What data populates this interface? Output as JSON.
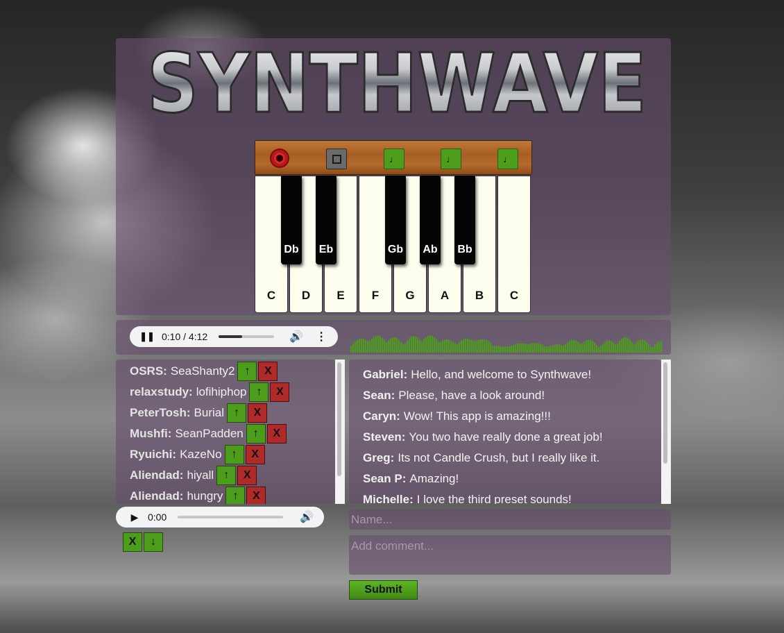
{
  "app": {
    "title": "SYNTHWAVE",
    "accent_green": "#4d9d1c",
    "accent_red": "#b12a2a",
    "panel_color": "#684e6c"
  },
  "piano": {
    "controls": [
      {
        "name": "record-button",
        "icon": "record-icon"
      },
      {
        "name": "stop-button",
        "icon": "stop-icon"
      },
      {
        "name": "preset-1-button",
        "icon": "music-note-icon",
        "glyph": "♩"
      },
      {
        "name": "preset-2-button",
        "icon": "music-note-icon",
        "glyph": "♩"
      },
      {
        "name": "preset-3-button",
        "icon": "music-note-icon",
        "glyph": "♩"
      }
    ],
    "white_keys": [
      "C",
      "D",
      "E",
      "F",
      "G",
      "A",
      "B",
      "C"
    ],
    "black_keys": [
      "Db",
      "Eb",
      "Gb",
      "Ab",
      "Bb"
    ]
  },
  "main_player": {
    "time": "0:10 / 4:12",
    "progress_fraction": 0.42,
    "icons": [
      "pause-icon",
      "volume-icon",
      "more-options-icon"
    ]
  },
  "queue": [
    {
      "user": "OSRS:",
      "track": "SeaShanty2",
      "up": "↑",
      "remove": "X"
    },
    {
      "user": "relaxstudy:",
      "track": "lofihiphop",
      "up": "↑",
      "remove": "X"
    },
    {
      "user": "PeterTosh:",
      "track": "Burial",
      "up": "↑",
      "remove": "X"
    },
    {
      "user": "Mushfi:",
      "track": "SeanPadden",
      "up": "↑",
      "remove": "X"
    },
    {
      "user": "Ryuichi:",
      "track": "KazeNo",
      "up": "↑",
      "remove": "X"
    },
    {
      "user": "Aliendad:",
      "track": "hiyall",
      "up": "↑",
      "remove": "X"
    },
    {
      "user": "Aliendad:",
      "track": "hungry",
      "up": "↑",
      "remove": "X"
    }
  ],
  "recording_player": {
    "time": "0:00",
    "progress_fraction": 0,
    "icons": [
      "play-icon",
      "volume-icon"
    ]
  },
  "recording_controls": {
    "delete_label": "X",
    "download_label": "↓"
  },
  "chat": [
    {
      "user": "Gabriel:",
      "message": "Hello, and welcome to Synthwave!"
    },
    {
      "user": "Sean:",
      "message": "Please, have a look around!"
    },
    {
      "user": "Caryn:",
      "message": "Wow! This app is amazing!!!"
    },
    {
      "user": "Steven:",
      "message": "You two have really done a great job!"
    },
    {
      "user": "Greg:",
      "message": "Its not Candle Crush, but I really like it."
    },
    {
      "user": "Sean P:",
      "message": "Amazing!"
    },
    {
      "user": "Michelle:",
      "message": "I love the third preset sounds!"
    }
  ],
  "form": {
    "name_placeholder": "Name...",
    "comment_placeholder": "Add comment...",
    "submit_label": "Submit"
  }
}
